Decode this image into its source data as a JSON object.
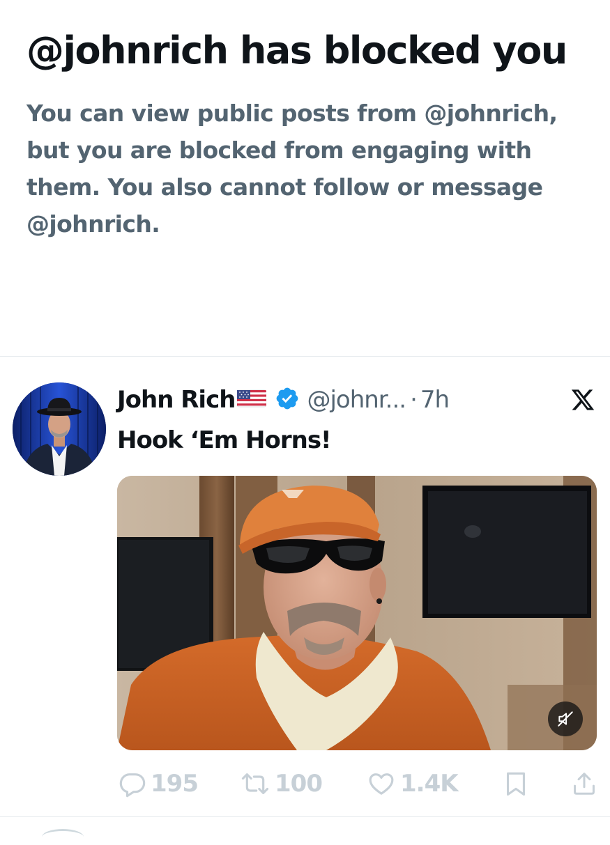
{
  "blocked_notice": {
    "title": "@johnrich has blocked you",
    "description": "You can view public posts from @johnrich, but you are blocked from engaging with them. You also cannot follow or message @johnrich."
  },
  "tweet": {
    "author": {
      "display_name": "John Rich",
      "flag_emoji": "🇺🇸",
      "verified": true,
      "handle": "@johnr...",
      "separator": "·",
      "time": "7h"
    },
    "text": "Hook ‘Em Horns!",
    "media": {
      "type": "video",
      "muted": true,
      "mute_icon": "speaker-muted-icon"
    },
    "actions": {
      "reply_count": "195",
      "repost_count": "100",
      "like_count": "1.4K"
    },
    "platform_icon": "x-logo-icon"
  },
  "colors": {
    "primary_text": "#0f1419",
    "secondary_text": "#536471",
    "verified_blue": "#1d9bf0",
    "action_disabled": "#c7d0d7",
    "divider": "#e6eaed"
  }
}
